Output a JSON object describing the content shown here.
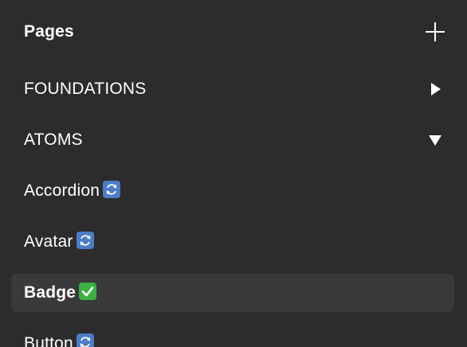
{
  "header": {
    "title": "Pages",
    "add_icon": "plus-icon"
  },
  "sections": [
    {
      "label": "FOUNDATIONS",
      "state": "collapsed",
      "icon": "triangle-right-icon"
    },
    {
      "label": "ATOMS",
      "state": "expanded",
      "icon": "triangle-down-icon"
    }
  ],
  "pages": [
    {
      "label": "Accordion",
      "status_icon": "refresh-emoji-icon"
    },
    {
      "label": "Avatar",
      "status_icon": "refresh-emoji-icon"
    },
    {
      "label": "Badge",
      "status_icon": "check-mark-button-emoji-icon",
      "selected": true
    },
    {
      "label": "Button",
      "status_icon": "refresh-emoji-icon"
    }
  ],
  "colors": {
    "background": "#2c2c2c",
    "selected_row": "#3a3a3a",
    "text": "#ffffff",
    "refresh_emoji": "#4d7cc7",
    "check_emoji": "#3cb043"
  }
}
